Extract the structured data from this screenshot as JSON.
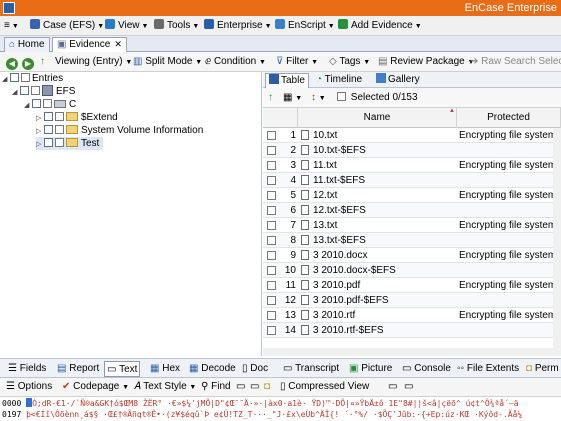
{
  "window": {
    "title": "EnCase Enterprise"
  },
  "menu": {
    "items": [
      {
        "label": "Case (EFS)",
        "icon": "briefcase-icon",
        "color": "#3b63a9"
      },
      {
        "label": "View",
        "icon": "view-icon",
        "color": "#2a7bc4"
      },
      {
        "label": "Tools",
        "icon": "gear-icon",
        "color": "#6a6a6a"
      },
      {
        "label": "Enterprise",
        "icon": "enterprise-icon",
        "color": "#2c5ea6"
      },
      {
        "label": "EnScript",
        "icon": "script-icon",
        "color": "#3f7fc9"
      },
      {
        "label": "Add Evidence",
        "icon": "add-evidence-icon",
        "color": "#2a8f3c"
      }
    ]
  },
  "tabs": [
    {
      "label": "Home"
    },
    {
      "label": "Evidence"
    }
  ],
  "toolbar": {
    "viewing": "Viewing (Entry)",
    "split": "Split Mode",
    "condition": "Condition",
    "filter": "Filter",
    "tags": "Tags",
    "review": "Review Package",
    "raw_search": "Raw Search Selected"
  },
  "tree": {
    "entries": "Entries",
    "efs": "EFS",
    "c": "C",
    "children": [
      "$Extend",
      "System Volume Information",
      "Test"
    ]
  },
  "view_tabs": [
    "Table",
    "Timeline",
    "Gallery"
  ],
  "table": {
    "selected": "Selected 0/153",
    "col_name": "Name",
    "col_protected": "Protected",
    "rows": [
      {
        "num": "1",
        "name": "10.txt",
        "protected": "Encrypting file system"
      },
      {
        "num": "2",
        "name": "10.txt-$EFS",
        "protected": ""
      },
      {
        "num": "3",
        "name": "11.txt",
        "protected": "Encrypting file system"
      },
      {
        "num": "4",
        "name": "11.txt-$EFS",
        "protected": ""
      },
      {
        "num": "5",
        "name": "12.txt",
        "protected": "Encrypting file system"
      },
      {
        "num": "6",
        "name": "12.txt-$EFS",
        "protected": ""
      },
      {
        "num": "7",
        "name": "13.txt",
        "protected": "Encrypting file system"
      },
      {
        "num": "8",
        "name": "13.txt-$EFS",
        "protected": ""
      },
      {
        "num": "9",
        "name": "3 2010.docx",
        "protected": "Encrypting file system"
      },
      {
        "num": "10",
        "name": "3 2010.docx-$EFS",
        "protected": ""
      },
      {
        "num": "11",
        "name": "3 2010.pdf",
        "protected": "Encrypting file system"
      },
      {
        "num": "12",
        "name": "3 2010.pdf-$EFS",
        "protected": ""
      },
      {
        "num": "13",
        "name": "3 2010.rtf",
        "protected": "Encrypting file system"
      },
      {
        "num": "14",
        "name": "3 2010.rtf-$EFS",
        "protected": ""
      }
    ]
  },
  "bottom_tabs": [
    "Fields",
    "Report",
    "Text",
    "Hex",
    "Decode",
    "Doc",
    "Transcript",
    "Picture",
    "Console",
    "File Extents",
    "Perm"
  ],
  "bottom_toolbar": {
    "options": "Options",
    "codepage": "Codepage",
    "text_style": "Text Style",
    "find": "Find",
    "compressed": "Compressed View"
  },
  "hex": {
    "line1_offset": "0000",
    "line1_data": "Ò;dR-€1·/`Ñ®a&GK†ó$ŒM8 ŽËR° ·€»$¼'jMÕ|D\"¢Œ¯¯Ä·»·|àx0·a1è· ŸD)™·DÕ|¤»ŸbÄ±ô 1E\"8#||š<â|çëõ^ ú¢t^Ô¾ªå´–ä",
    "line2_offset": "0197",
    "line2_data": "þ<€Íî\\Ôõènn¸á$§ ·Œ£†®Ãñqt®Ê•·(z¥$éqû`Þ e¢Ü!TZ_T···_\"J·£x\\eÙb^ÄÎ{! ´·°%/ ·$ÕÇ'Jûb:·{+Ep:úz·KŒ ·Kýôd-.Ãå¼"
  }
}
